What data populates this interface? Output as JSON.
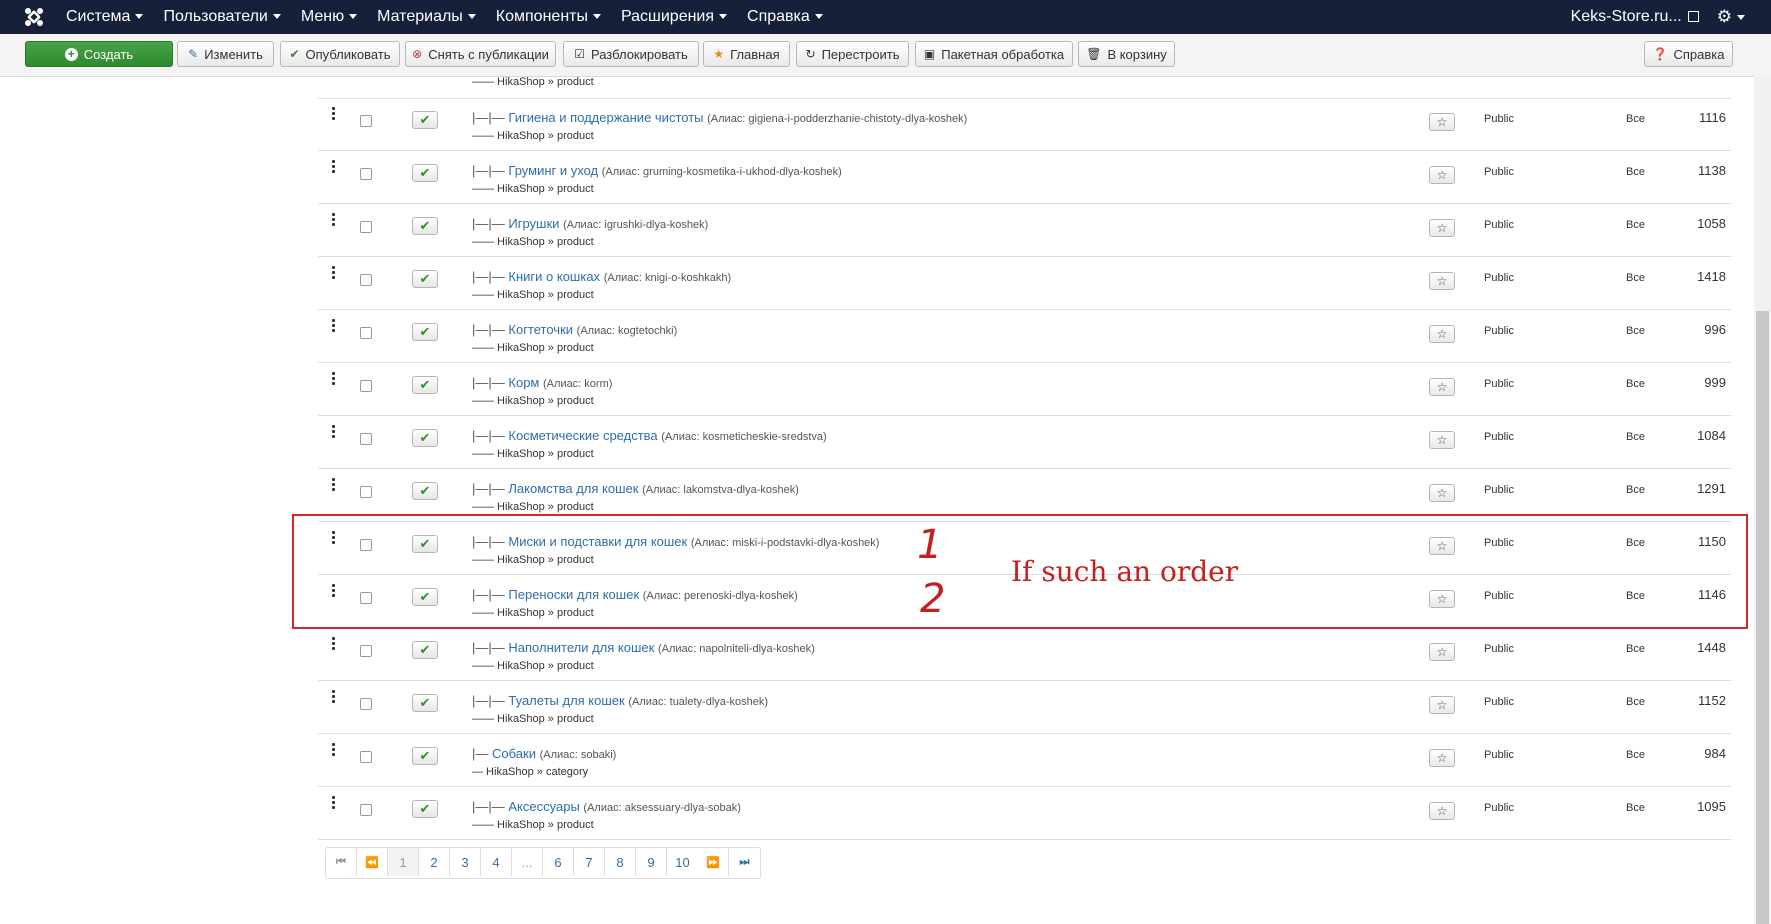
{
  "nav": {
    "items": [
      "Система",
      "Пользователи",
      "Меню",
      "Материалы",
      "Компоненты",
      "Расширения",
      "Справка"
    ],
    "site_name": "Keks-Store.ru..."
  },
  "toolbar": {
    "create": "Создать",
    "edit": "Изменить",
    "publish": "Опубликовать",
    "unpublish": "Снять с публикации",
    "checkin": "Разблокировать",
    "featured": "Главная",
    "rebuild": "Перестроить",
    "batch": "Пакетная обработка",
    "trash": "В корзину",
    "help": "Справка"
  },
  "partial_row_sub": "—— HikaShop » product",
  "rows": [
    {
      "tree": "|—|—",
      "title": "Гигиена и поддержание чистоты",
      "alias": "(Алиас: gigiena-i-podderzhanie-chistoty-dlya-koshek)",
      "sub": "—— HikaShop » product",
      "access": "Public",
      "lang": "Все",
      "id": "1116"
    },
    {
      "tree": "|—|—",
      "title": "Груминг и уход",
      "alias": "(Алиас: gruming-kosmetika-i-ukhod-dlya-koshek)",
      "sub": "—— HikaShop » product",
      "access": "Public",
      "lang": "Все",
      "id": "1138"
    },
    {
      "tree": "|—|—",
      "title": "Игрушки",
      "alias": "(Алиас: igrushki-dlya-koshek)",
      "sub": "—— HikaShop » product",
      "access": "Public",
      "lang": "Все",
      "id": "1058"
    },
    {
      "tree": "|—|—",
      "title": "Книги о кошках",
      "alias": "(Алиас: knigi-o-koshkakh)",
      "sub": "—— HikaShop » product",
      "access": "Public",
      "lang": "Все",
      "id": "1418"
    },
    {
      "tree": "|—|—",
      "title": "Когтеточки",
      "alias": "(Алиас: kogtetochki)",
      "sub": "—— HikaShop » product",
      "access": "Public",
      "lang": "Все",
      "id": "996"
    },
    {
      "tree": "|—|—",
      "title": "Корм",
      "alias": "(Алиас: korm)",
      "sub": "—— HikaShop » product",
      "access": "Public",
      "lang": "Все",
      "id": "999"
    },
    {
      "tree": "|—|—",
      "title": "Косметические средства",
      "alias": "(Алиас: kosmeticheskie-sredstva)",
      "sub": "—— HikaShop » product",
      "access": "Public",
      "lang": "Все",
      "id": "1084"
    },
    {
      "tree": "|—|—",
      "title": "Лакомства для кошек",
      "alias": "(Алиас: lakomstva-dlya-koshek)",
      "sub": "—— HikaShop » product",
      "access": "Public",
      "lang": "Все",
      "id": "1291"
    },
    {
      "tree": "|—|—",
      "title": "Миски и подставки для кошек",
      "alias": "(Алиас: miski-i-podstavki-dlya-koshek)",
      "sub": "—— HikaShop » product",
      "access": "Public",
      "lang": "Все",
      "id": "1150"
    },
    {
      "tree": "|—|—",
      "title": "Переноски для кошек",
      "alias": "(Алиас: perenoski-dlya-koshek)",
      "sub": "—— HikaShop » product",
      "access": "Public",
      "lang": "Все",
      "id": "1146"
    },
    {
      "tree": "|—|—",
      "title": "Наполнители для кошек",
      "alias": "(Алиас: napolniteli-dlya-koshek)",
      "sub": "—— HikaShop » product",
      "access": "Public",
      "lang": "Все",
      "id": "1448"
    },
    {
      "tree": "|—|—",
      "title": "Туалеты для кошек",
      "alias": "(Алиас: tualety-dlya-koshek)",
      "sub": "—— HikaShop » product",
      "access": "Public",
      "lang": "Все",
      "id": "1152"
    },
    {
      "tree": "|—",
      "title": "Собаки",
      "alias": "(Алиас: sobaki)",
      "sub": "— HikaShop » category",
      "access": "Public",
      "lang": "Все",
      "id": "984"
    },
    {
      "tree": "|—|—",
      "title": "Аксессуары",
      "alias": "(Алиас: aksessuary-dlya-sobak)",
      "sub": "—— HikaShop » product",
      "access": "Public",
      "lang": "Все",
      "id": "1095"
    }
  ],
  "annotation": {
    "text": "If such an order",
    "num1": "1",
    "num2": "2",
    "color": "#c52020"
  },
  "pagination": {
    "pages": [
      "1",
      "2",
      "3",
      "4",
      "...",
      "6",
      "7",
      "8",
      "9",
      "10"
    ],
    "current": "1"
  },
  "colors": {
    "navbar": "#17203a",
    "link": "#2f6eab",
    "create_button": "#46a546"
  }
}
